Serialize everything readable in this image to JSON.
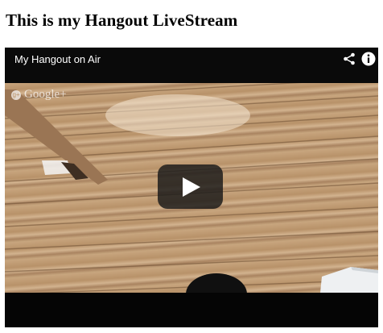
{
  "page": {
    "heading": "This is my Hangout LiveStream"
  },
  "player": {
    "title": "My Hangout on Air",
    "watermark": "Google+",
    "icons": {
      "share": "share-icon",
      "info": "info-icon",
      "play": "play-icon",
      "watermark": "google-plus-icon"
    },
    "colors": {
      "chrome": "#0a0a0a",
      "play_button_bg": "#181818",
      "wood": "#c7a47d"
    }
  }
}
